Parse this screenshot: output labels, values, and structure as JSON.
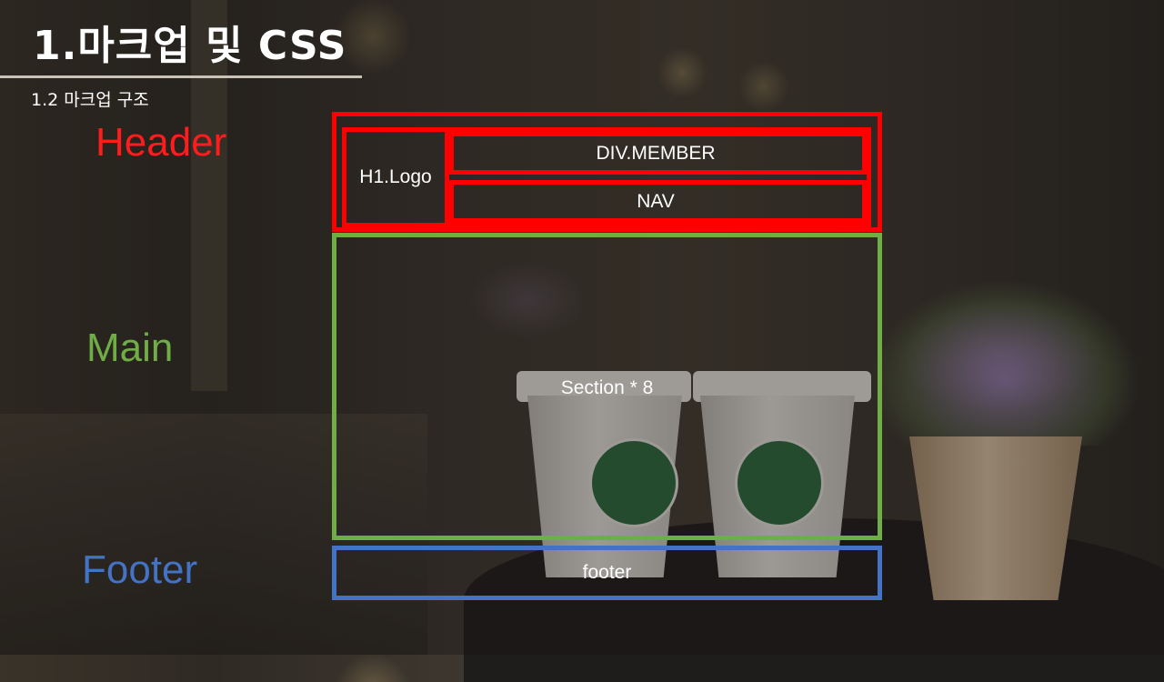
{
  "slide": {
    "title": "1.마크업 및 CSS",
    "subtitle": "1.2 마크업 구조"
  },
  "labels": {
    "header": "Header",
    "main": "Main",
    "footer": "Footer"
  },
  "boxes": {
    "logo": "H1.Logo",
    "member": "DIV.MEMBER",
    "nav": "NAV",
    "section": "Section  * 8",
    "footer": "footer"
  },
  "colors": {
    "header": "#ff0000",
    "main": "#70ad47",
    "footer": "#4472c4"
  }
}
